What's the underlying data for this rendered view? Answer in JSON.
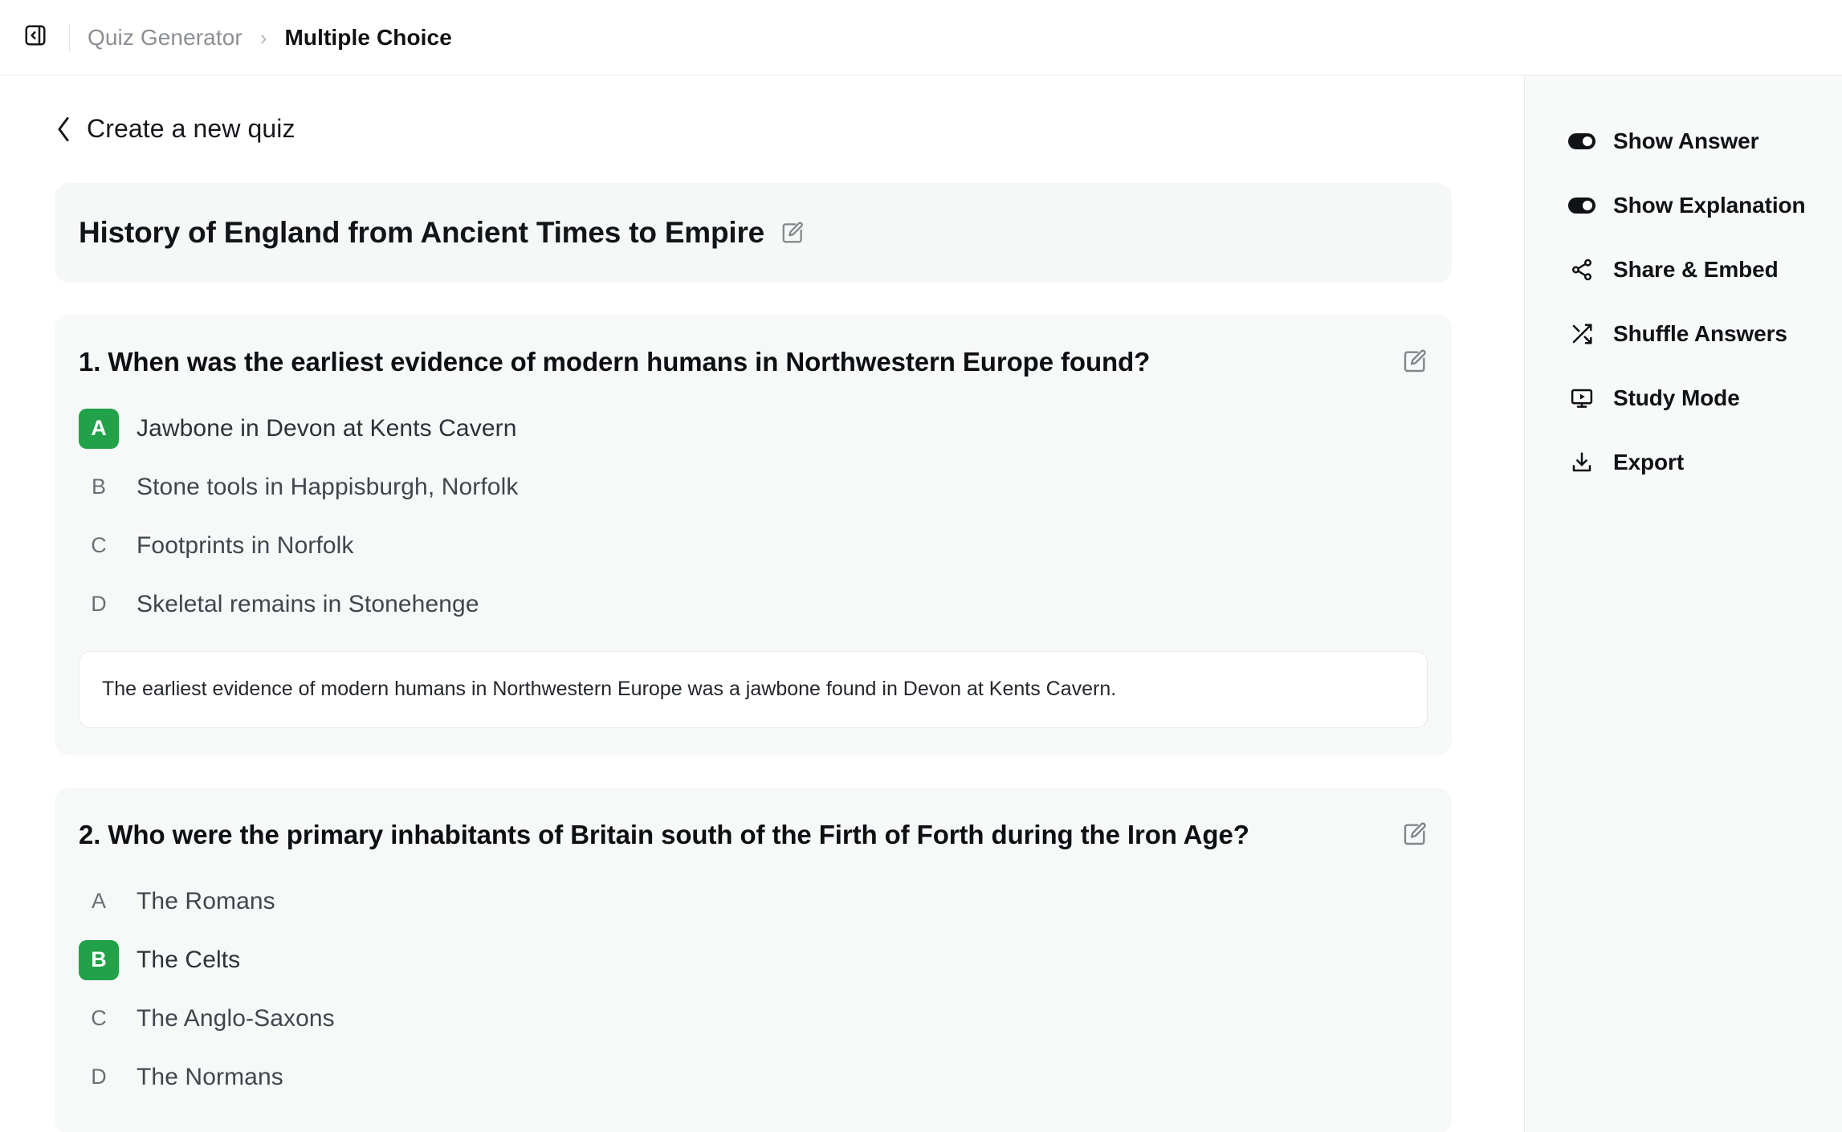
{
  "topbar": {
    "panel_toggle_icon": "panel-collapse-icon",
    "breadcrumb": {
      "parent": "Quiz Generator",
      "separator": "›",
      "current": "Multiple Choice"
    }
  },
  "main": {
    "back_link": {
      "icon": "chevron-left-icon",
      "label": "Create a new quiz"
    },
    "quiz_title": "History of England from Ancient Times to Empire",
    "title_edit_icon": "edit-pencil-icon",
    "correct_color": "#21a148",
    "questions": [
      {
        "number": "1.",
        "text": "1. When was the earliest evidence of modern humans in Northwestern Europe found?",
        "edit_icon": "edit-pencil-icon",
        "options": [
          {
            "letter": "A",
            "text": "Jawbone in Devon at Kents Cavern",
            "correct": true
          },
          {
            "letter": "B",
            "text": "Stone tools in Happisburgh, Norfolk",
            "correct": false
          },
          {
            "letter": "C",
            "text": "Footprints in Norfolk",
            "correct": false
          },
          {
            "letter": "D",
            "text": "Skeletal remains in Stonehenge",
            "correct": false
          }
        ],
        "explanation": "The earliest evidence of modern humans in Northwestern Europe was a jawbone found in Devon at Kents Cavern."
      },
      {
        "number": "2.",
        "text": "2. Who were the primary inhabitants of Britain south of the Firth of Forth during the Iron Age?",
        "edit_icon": "edit-pencil-icon",
        "options": [
          {
            "letter": "A",
            "text": "The Romans",
            "correct": false
          },
          {
            "letter": "B",
            "text": "The Celts",
            "correct": true
          },
          {
            "letter": "C",
            "text": "The Anglo-Saxons",
            "correct": false
          },
          {
            "letter": "D",
            "text": "The Normans",
            "correct": false
          }
        ],
        "explanation": ""
      }
    ]
  },
  "right_panel": {
    "items": [
      {
        "label": "Show Answer",
        "icon": "toggle-on-icon",
        "type": "toggle",
        "enabled": "on"
      },
      {
        "label": "Show Explanation",
        "icon": "toggle-on-icon",
        "type": "toggle",
        "enabled": "on"
      },
      {
        "label": "Share & Embed",
        "icon": "share-icon",
        "type": "action"
      },
      {
        "label": "Shuffle Answers",
        "icon": "shuffle-icon",
        "type": "action"
      },
      {
        "label": "Study Mode",
        "icon": "study-mode-icon",
        "type": "action"
      },
      {
        "label": "Export",
        "icon": "download-icon",
        "type": "action"
      }
    ]
  }
}
